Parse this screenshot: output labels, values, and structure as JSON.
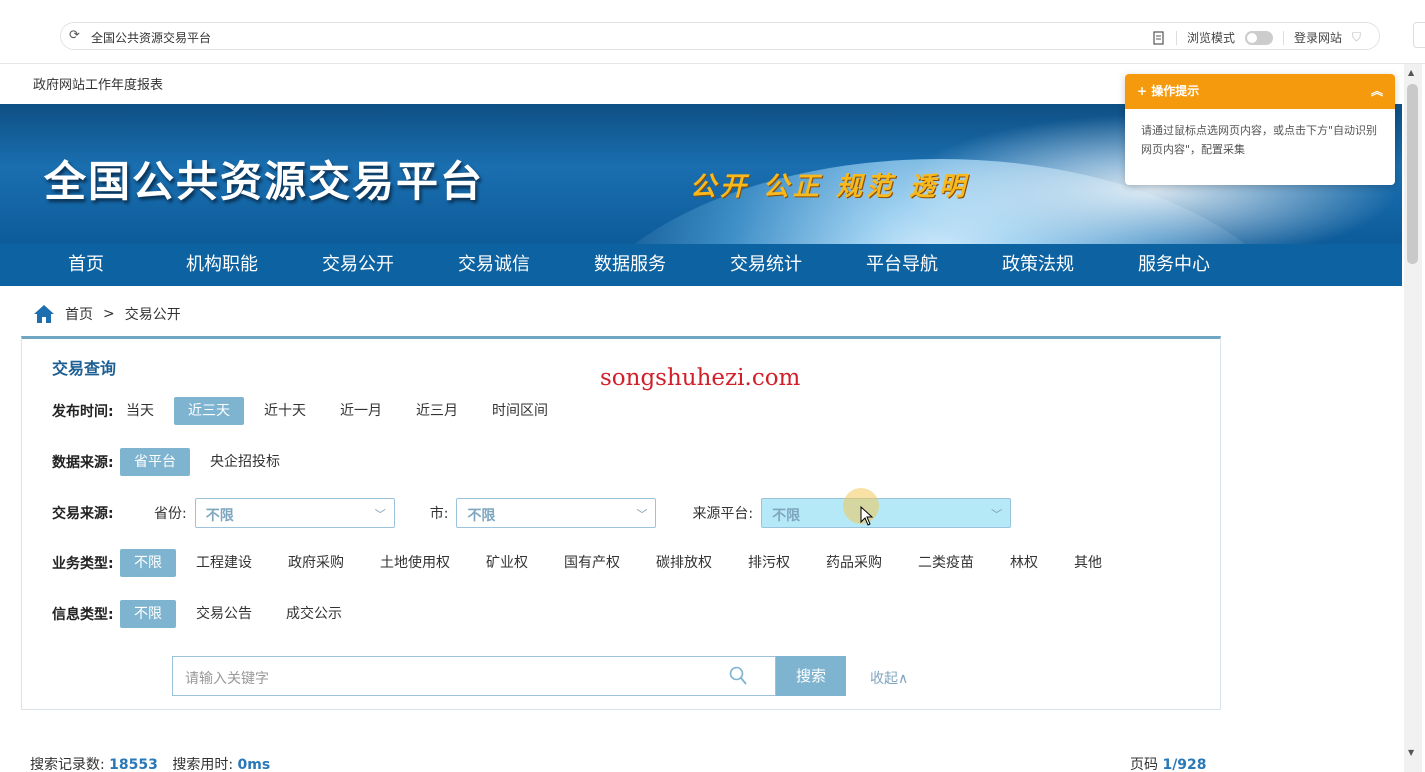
{
  "browser": {
    "url": "全国公共资源交易平台",
    "reading_mode_label": "浏览模式",
    "login_label": "登录网站"
  },
  "topline": "政府网站工作年度报表",
  "banner": {
    "site_title": "全国公共资源交易平台",
    "slogan": "公开 公正 规范 透明"
  },
  "nav": [
    "首页",
    "机构职能",
    "交易公开",
    "交易诚信",
    "数据服务",
    "交易统计",
    "平台导航",
    "政策法规",
    "服务中心"
  ],
  "breadcrumb": {
    "home": "首页",
    "separator": ">",
    "current": "交易公开"
  },
  "panel": {
    "title": "交易查询",
    "watermark": "songshuhezi.com",
    "publish_time": {
      "label": "发布时间:",
      "options": [
        "当天",
        "近三天",
        "近十天",
        "近一月",
        "近三月",
        "时间区间"
      ],
      "selected": "近三天"
    },
    "data_source": {
      "label": "数据来源:",
      "options": [
        "省平台",
        "央企招投标"
      ],
      "selected": "省平台"
    },
    "trade_source": {
      "label": "交易来源:",
      "province_label": "省份:",
      "province_value": "不限",
      "city_label": "市:",
      "city_value": "不限",
      "platform_label": "来源平台:",
      "platform_value": "不限"
    },
    "business_type": {
      "label": "业务类型:",
      "options": [
        "不限",
        "工程建设",
        "政府采购",
        "土地使用权",
        "矿业权",
        "国有产权",
        "碳排放权",
        "排污权",
        "药品采购",
        "二类疫苗",
        "林权",
        "其他"
      ],
      "selected": "不限"
    },
    "info_type": {
      "label": "信息类型:",
      "options": [
        "不限",
        "交易公告",
        "成交公示"
      ],
      "selected": "不限"
    },
    "search": {
      "placeholder": "请输入关键字",
      "button": "搜索",
      "collapse": "收起∧"
    }
  },
  "stats": {
    "records_label": "搜索记录数:",
    "records_value": "18553",
    "time_label": "搜索用时:",
    "time_value": "0ms",
    "page_label": "页码",
    "page_value": "1/928"
  },
  "tip": {
    "title": "操作提示",
    "body": "请通过鼠标点选网页内容，或点击下方\"自动识别网页内容\"，配置采集"
  },
  "colors": {
    "nav_bg": "#0d62a1",
    "active_option": "#7fb4d0",
    "tip_header": "#f59a0c",
    "watermark": "#d1202a"
  }
}
